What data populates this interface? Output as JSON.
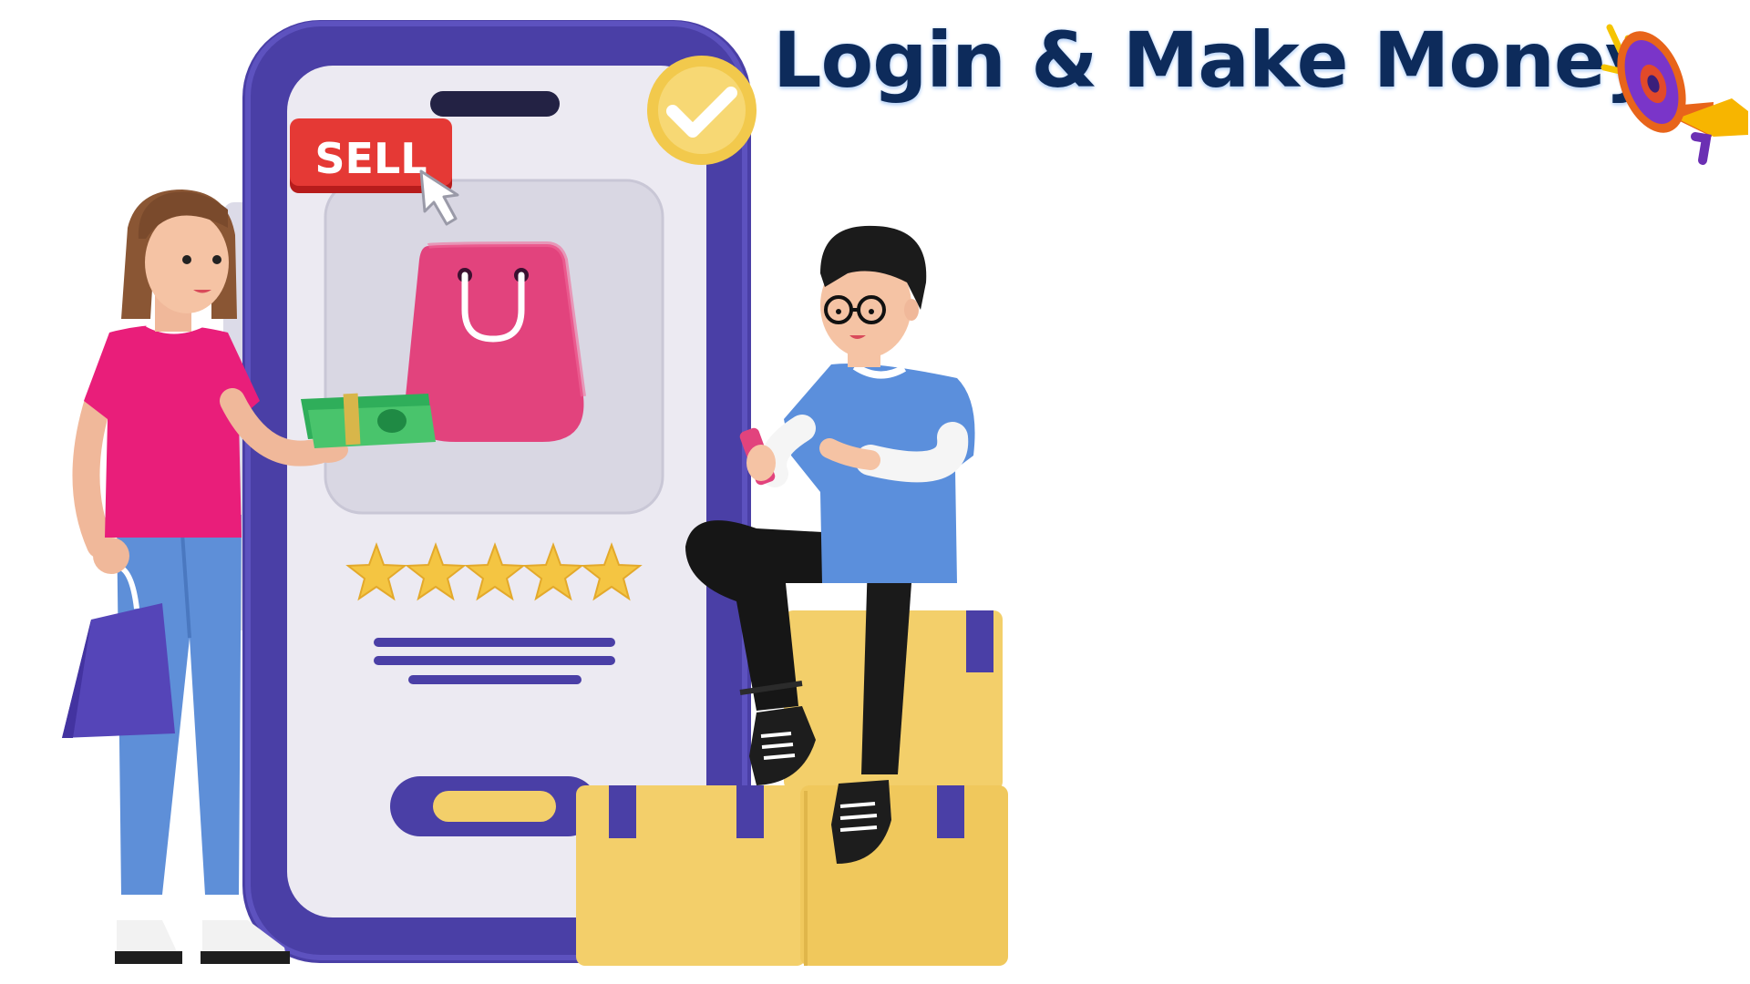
{
  "headline": {
    "text": "Login & Make Money"
  },
  "sell_button": {
    "label": "SELL"
  },
  "rating": {
    "stars": 5,
    "max": 5
  },
  "icons": {
    "megaphone": "megaphone-icon",
    "check": "check-badge-icon",
    "cursor": "cursor-icon",
    "shopping_bag": "shopping-bag-icon"
  },
  "colors": {
    "headline": "#0d2b5b",
    "phone_frame": "#4a3fa6",
    "sell": "#e53935",
    "shirt_woman": "#e91e7a",
    "shirt_man": "#5b8fdc",
    "box": "#f3cf6a",
    "star": "#f4c542"
  }
}
